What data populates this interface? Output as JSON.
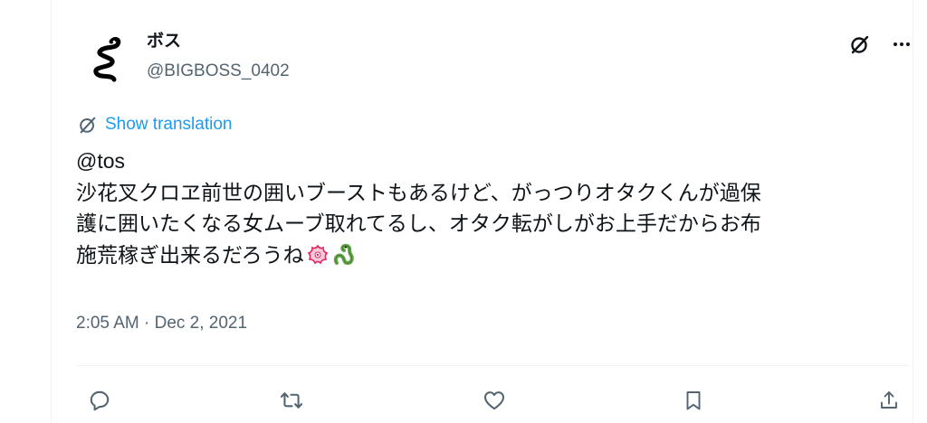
{
  "author": {
    "display_name": "ボス",
    "handle": "@BIGBOSS_0402",
    "avatar_icon": "snake-avatar-icon"
  },
  "header": {
    "grok_icon": "grok-icon",
    "more_icon": "more-icon"
  },
  "translation": {
    "label": "Show translation",
    "icon": "globe-slash-icon"
  },
  "tweet": {
    "mention": "@tos",
    "lines": [
      "沙花叉クロヱ前世の囲いブーストもあるけど、がっつりオタクくんが過保",
      "護に囲いたくなる女ムーブ取れてるし、オタク転がしがお上手だからお布",
      "施荒稼ぎ出来るだろうね"
    ],
    "emojis": [
      "cherry-blossom-emoji",
      "snake-emoji"
    ]
  },
  "meta": {
    "time": "2:05 AM",
    "separator": " · ",
    "date": "Dec 2, 2021"
  },
  "actions": {
    "icons": [
      "reply-icon",
      "retweet-icon",
      "like-icon",
      "bookmark-icon",
      "share-icon"
    ]
  },
  "colors": {
    "text": "#0f1419",
    "secondary": "#536471",
    "link": "#1d9bf0",
    "border": "#eff3f4"
  }
}
